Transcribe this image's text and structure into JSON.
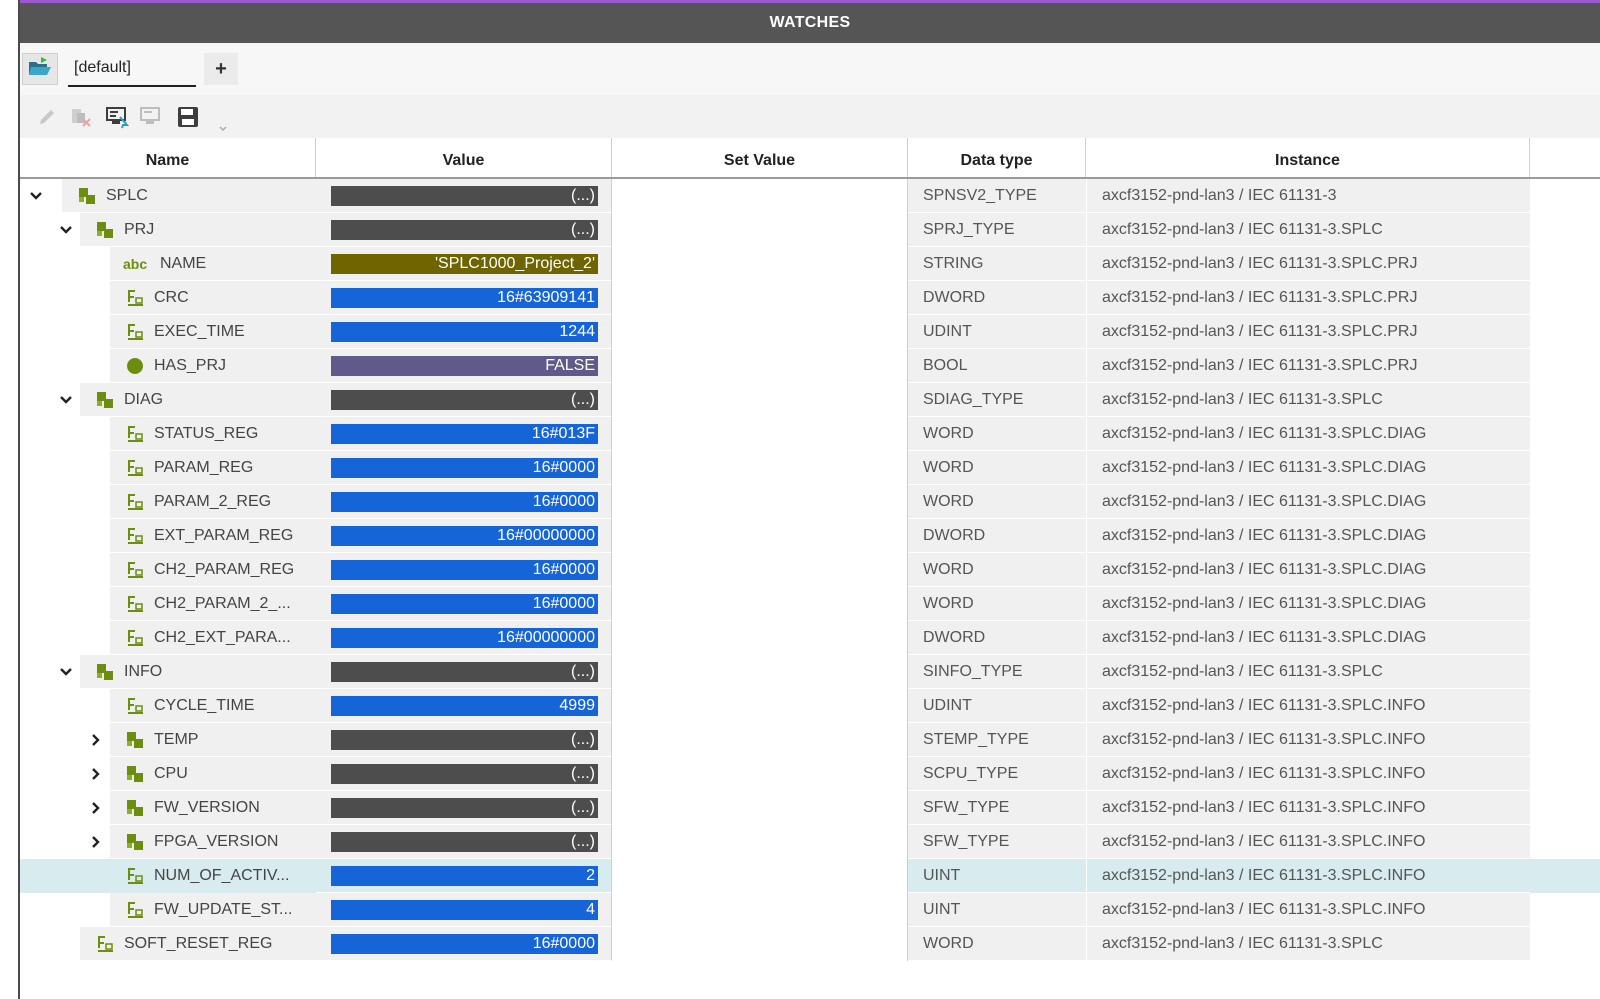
{
  "window": {
    "title": "WATCHES"
  },
  "tabs": {
    "active_label": "[default]",
    "add_label": "+"
  },
  "toolbar": {
    "tools": [
      "pencil-icon",
      "delete-variable-icon",
      "monitor-select-icon",
      "monitor-icon",
      "save-icon"
    ]
  },
  "columns": {
    "name": "Name",
    "value": "Value",
    "set_value": "Set Value",
    "data_type": "Data type",
    "instance": "Instance"
  },
  "colors": {
    "accent": "#9b59d0",
    "numeric": "#1565d8",
    "struct": "#4d4d4d",
    "string": "#6e6400",
    "bool": "#5f5a8a",
    "icon_green": "#6b8e0f",
    "selected_row": "#d8ebef"
  },
  "rows": [
    {
      "level": 0,
      "expander": "expanded",
      "icon": "struct-icon",
      "name": "SPLC",
      "value": "(...)",
      "vtype": "struct",
      "data_type": "SPNSV2_TYPE",
      "instance": "axcf3152-pnd-lan3 / IEC 61131-3"
    },
    {
      "level": 1,
      "expander": "expanded",
      "icon": "struct-icon",
      "name": "PRJ",
      "value": "(...)",
      "vtype": "struct",
      "data_type": "SPRJ_TYPE",
      "instance": "axcf3152-pnd-lan3 / IEC 61131-3.SPLC"
    },
    {
      "level": 2,
      "expander": "none",
      "icon": "string-icon",
      "name": "NAME",
      "value": "'SPLC1000_Project_2'",
      "vtype": "str",
      "data_type": "STRING",
      "instance": "axcf3152-pnd-lan3 / IEC 61131-3.SPLC.PRJ"
    },
    {
      "level": 2,
      "expander": "none",
      "icon": "elementary-icon",
      "name": "CRC",
      "value": "16#63909141",
      "vtype": "num",
      "data_type": "DWORD",
      "instance": "axcf3152-pnd-lan3 / IEC 61131-3.SPLC.PRJ"
    },
    {
      "level": 2,
      "expander": "none",
      "icon": "elementary-icon",
      "name": "EXEC_TIME",
      "value": "1244",
      "vtype": "num",
      "data_type": "UDINT",
      "instance": "axcf3152-pnd-lan3 / IEC 61131-3.SPLC.PRJ"
    },
    {
      "level": 2,
      "expander": "none",
      "icon": "bool-icon",
      "name": "HAS_PRJ",
      "value": "FALSE",
      "vtype": "bool",
      "data_type": "BOOL",
      "instance": "axcf3152-pnd-lan3 / IEC 61131-3.SPLC.PRJ"
    },
    {
      "level": 1,
      "expander": "expanded",
      "icon": "struct-icon",
      "name": "DIAG",
      "value": "(...)",
      "vtype": "struct",
      "data_type": "SDIAG_TYPE",
      "instance": "axcf3152-pnd-lan3 / IEC 61131-3.SPLC"
    },
    {
      "level": 2,
      "expander": "none",
      "icon": "elementary-icon",
      "name": "STATUS_REG",
      "value": "16#013F",
      "vtype": "num",
      "data_type": "WORD",
      "instance": "axcf3152-pnd-lan3 / IEC 61131-3.SPLC.DIAG"
    },
    {
      "level": 2,
      "expander": "none",
      "icon": "elementary-icon",
      "name": "PARAM_REG",
      "value": "16#0000",
      "vtype": "num",
      "data_type": "WORD",
      "instance": "axcf3152-pnd-lan3 / IEC 61131-3.SPLC.DIAG"
    },
    {
      "level": 2,
      "expander": "none",
      "icon": "elementary-icon",
      "name": "PARAM_2_REG",
      "value": "16#0000",
      "vtype": "num",
      "data_type": "WORD",
      "instance": "axcf3152-pnd-lan3 / IEC 61131-3.SPLC.DIAG"
    },
    {
      "level": 2,
      "expander": "none",
      "icon": "elementary-icon",
      "name": "EXT_PARAM_REG",
      "value": "16#00000000",
      "vtype": "num",
      "data_type": "DWORD",
      "instance": "axcf3152-pnd-lan3 / IEC 61131-3.SPLC.DIAG"
    },
    {
      "level": 2,
      "expander": "none",
      "icon": "elementary-icon",
      "name": "CH2_PARAM_REG",
      "value": "16#0000",
      "vtype": "num",
      "data_type": "WORD",
      "instance": "axcf3152-pnd-lan3 / IEC 61131-3.SPLC.DIAG"
    },
    {
      "level": 2,
      "expander": "none",
      "icon": "elementary-icon",
      "name": "CH2_PARAM_2_...",
      "value": "16#0000",
      "vtype": "num",
      "data_type": "WORD",
      "instance": "axcf3152-pnd-lan3 / IEC 61131-3.SPLC.DIAG"
    },
    {
      "level": 2,
      "expander": "none",
      "icon": "elementary-icon",
      "name": "CH2_EXT_PARA...",
      "value": "16#00000000",
      "vtype": "num",
      "data_type": "DWORD",
      "instance": "axcf3152-pnd-lan3 / IEC 61131-3.SPLC.DIAG"
    },
    {
      "level": 1,
      "expander": "expanded",
      "icon": "struct-icon",
      "name": "INFO",
      "value": "(...)",
      "vtype": "struct",
      "data_type": "SINFO_TYPE",
      "instance": "axcf3152-pnd-lan3 / IEC 61131-3.SPLC"
    },
    {
      "level": 2,
      "expander": "none",
      "icon": "elementary-icon",
      "name": "CYCLE_TIME",
      "value": "4999",
      "vtype": "num",
      "data_type": "UDINT",
      "instance": "axcf3152-pnd-lan3 / IEC 61131-3.SPLC.INFO"
    },
    {
      "level": 2,
      "expander": "collapsed",
      "icon": "struct-icon",
      "name": "TEMP",
      "value": "(...)",
      "vtype": "struct",
      "data_type": "STEMP_TYPE",
      "instance": "axcf3152-pnd-lan3 / IEC 61131-3.SPLC.INFO"
    },
    {
      "level": 2,
      "expander": "collapsed",
      "icon": "struct-icon",
      "name": "CPU",
      "value": "(...)",
      "vtype": "struct",
      "data_type": "SCPU_TYPE",
      "instance": "axcf3152-pnd-lan3 / IEC 61131-3.SPLC.INFO"
    },
    {
      "level": 2,
      "expander": "collapsed",
      "icon": "struct-icon",
      "name": "FW_VERSION",
      "value": "(...)",
      "vtype": "struct",
      "data_type": "SFW_TYPE",
      "instance": "axcf3152-pnd-lan3 / IEC 61131-3.SPLC.INFO"
    },
    {
      "level": 2,
      "expander": "collapsed",
      "icon": "struct-icon",
      "name": "FPGA_VERSION",
      "value": "(...)",
      "vtype": "struct",
      "data_type": "SFW_TYPE",
      "instance": "axcf3152-pnd-lan3 / IEC 61131-3.SPLC.INFO"
    },
    {
      "level": 2,
      "expander": "none",
      "icon": "elementary-icon",
      "name": "NUM_OF_ACTIV...",
      "value": "2",
      "vtype": "num",
      "data_type": "UINT",
      "instance": "axcf3152-pnd-lan3 / IEC 61131-3.SPLC.INFO",
      "selected": true
    },
    {
      "level": 2,
      "expander": "none",
      "icon": "elementary-icon",
      "name": "FW_UPDATE_ST...",
      "value": "4",
      "vtype": "num",
      "data_type": "UINT",
      "instance": "axcf3152-pnd-lan3 / IEC 61131-3.SPLC.INFO"
    },
    {
      "level": 1,
      "expander": "none",
      "icon": "elementary-icon",
      "name": "SOFT_RESET_REG",
      "value": "16#0000",
      "vtype": "num",
      "data_type": "WORD",
      "instance": "axcf3152-pnd-lan3 / IEC 61131-3.SPLC"
    }
  ]
}
